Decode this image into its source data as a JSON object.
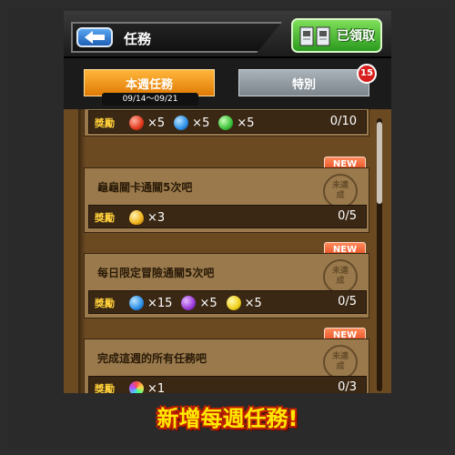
{
  "header": {
    "title": "任務",
    "back_icon": "back-arrow-icon",
    "claim_all_label": "已領取"
  },
  "tabs": {
    "weekly": {
      "label": "本週任務",
      "dates": "09/14～09/21"
    },
    "special": {
      "label": "特別",
      "badge": "15"
    }
  },
  "missions": [
    {
      "name": "",
      "reward_label": "獎勵",
      "rewards": [
        {
          "icon": "red-gem-icon",
          "color": "#e23a1c",
          "qty": "×5"
        },
        {
          "icon": "blue-gem-icon",
          "color": "#2c8fe8",
          "qty": "×5"
        },
        {
          "icon": "green-gem-icon",
          "color": "#3cc23a",
          "qty": "×5"
        }
      ],
      "progress": "0/10",
      "is_new": false,
      "new_label": "",
      "stamp_text": ""
    },
    {
      "name": "龜龜關卡通關5次吧",
      "reward_label": "獎勵",
      "rewards": [
        {
          "icon": "golden-egg-icon",
          "color": "#f0b21a",
          "qty": "×3"
        }
      ],
      "progress": "0/5",
      "is_new": true,
      "new_label": "NEW",
      "stamp_text": "未達成"
    },
    {
      "name": "每日限定冒險通關5次吧",
      "reward_label": "獎勵",
      "rewards": [
        {
          "icon": "blue-gem-icon",
          "color": "#2c8fe8",
          "qty": "×15"
        },
        {
          "icon": "purple-gem-icon",
          "color": "#9b3ad8",
          "qty": "×5"
        },
        {
          "icon": "yellow-gem-icon",
          "color": "#f0d01a",
          "qty": "×5"
        }
      ],
      "progress": "0/5",
      "is_new": true,
      "new_label": "NEW",
      "stamp_text": "未達成"
    },
    {
      "name": "完成這週的所有任務吧",
      "reward_label": "獎勵",
      "rewards": [
        {
          "icon": "rainbow-orb-icon",
          "color": "#c070e0",
          "qty": "×1"
        }
      ],
      "progress": "0/3",
      "is_new": true,
      "new_label": "NEW",
      "stamp_text": "未達成"
    }
  ],
  "caption": "新增每週任務!"
}
